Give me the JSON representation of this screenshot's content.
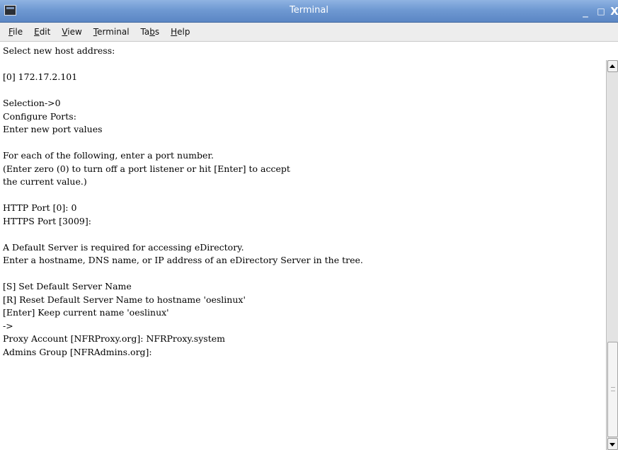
{
  "window": {
    "title": "Terminal",
    "controls": {
      "minimize": "_",
      "maximize": "□",
      "close": "X"
    }
  },
  "menubar": {
    "items": [
      {
        "label": "File",
        "mnemonic_index": 0
      },
      {
        "label": "Edit",
        "mnemonic_index": 0
      },
      {
        "label": "View",
        "mnemonic_index": 0
      },
      {
        "label": "Terminal",
        "mnemonic_index": 0
      },
      {
        "label": "Tabs",
        "mnemonic_index": 2
      },
      {
        "label": "Help",
        "mnemonic_index": 0
      }
    ]
  },
  "terminal": {
    "lines": [
      "Select new host address:",
      "",
      "[0] 172.17.2.101",
      "",
      "Selection->0",
      "Configure Ports:",
      "Enter new port values",
      "",
      "For each of the following, enter a port number.",
      "(Enter zero (0) to turn off a port listener or hit [Enter] to accept",
      "the current value.)",
      "",
      "HTTP Port [0]: 0",
      "HTTPS Port [3009]:",
      "",
      "A Default Server is required for accessing eDirectory.",
      "Enter a hostname, DNS name, or IP address of an eDirectory Server in the tree.",
      "",
      "[S] Set Default Server Name",
      "[R] Reset Default Server Name to hostname 'oeslinux'",
      "[Enter] Keep current name 'oeslinux'",
      "->",
      "Proxy Account [NFRProxy.org]: NFRProxy.system",
      "Admins Group [NFRAdmins.org]:"
    ]
  },
  "icons": {
    "window_icon": "terminal-icon",
    "scroll_up": "arrow-up-icon",
    "scroll_down": "arrow-down-icon"
  },
  "colors": {
    "titlebar": "#6f99d2",
    "menubar": "#ededed",
    "terminal_bg": "#ffffff",
    "terminal_fg": "#000000"
  }
}
